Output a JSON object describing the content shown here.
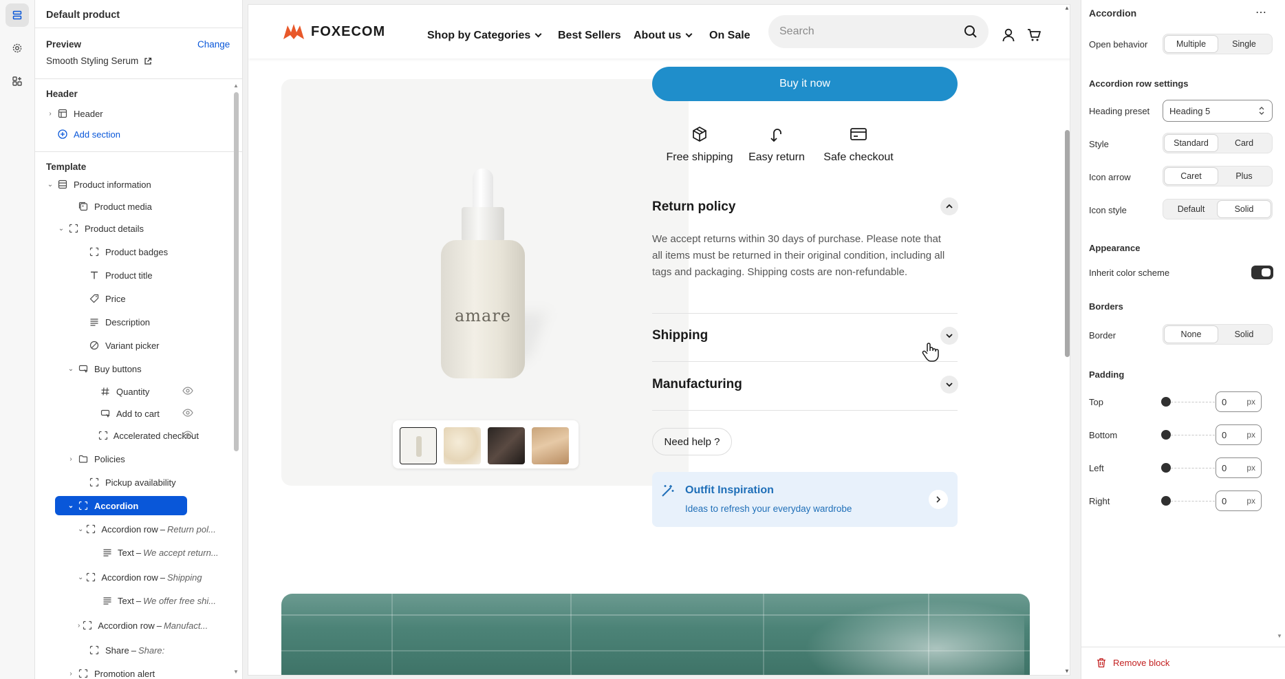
{
  "left_panel": {
    "title": "Default product",
    "preview_label": "Preview",
    "change_link": "Change",
    "preview_value": "Smooth Styling Serum",
    "header_section_title": "Header",
    "header_item": "Header",
    "add_section": "Add section",
    "template_title": "Template",
    "tree": [
      {
        "label": "Product information",
        "sub": ""
      },
      {
        "label": "Product media",
        "sub": ""
      },
      {
        "label": "Product details",
        "sub": ""
      },
      {
        "label": "Product badges",
        "sub": ""
      },
      {
        "label": "Product title",
        "sub": ""
      },
      {
        "label": "Price",
        "sub": ""
      },
      {
        "label": "Description",
        "sub": ""
      },
      {
        "label": "Variant picker",
        "sub": ""
      },
      {
        "label": "Buy buttons",
        "sub": ""
      },
      {
        "label": "Quantity",
        "sub": ""
      },
      {
        "label": "Add to cart",
        "sub": ""
      },
      {
        "label": "Accelerated checkout",
        "sub": ""
      },
      {
        "label": "Policies",
        "sub": ""
      },
      {
        "label": "Pickup availability",
        "sub": ""
      },
      {
        "label": "Accordion",
        "sub": ""
      },
      {
        "label": "Accordion row",
        "sub": "Return pol..."
      },
      {
        "label": "Text",
        "sub": "We accept return..."
      },
      {
        "label": "Accordion row",
        "sub": "Shipping"
      },
      {
        "label": "Text",
        "sub": "We offer free shi..."
      },
      {
        "label": "Accordion row",
        "sub": "Manufact..."
      },
      {
        "label": "Share",
        "sub": "Share:"
      },
      {
        "label": "Promotion alert",
        "sub": ""
      }
    ]
  },
  "store": {
    "logo_text": "FOXECOM",
    "nav": [
      "Shop by Categories",
      "Best Sellers",
      "About us",
      "On Sale"
    ],
    "search_placeholder": "Search",
    "buy_now": "Buy it now",
    "features": [
      "Free shipping",
      "Easy return",
      "Safe checkout"
    ],
    "product_label": "amare",
    "accordion": [
      {
        "title": "Return policy",
        "body": "We accept returns within 30 days of purchase. Please note that all items must be returned in their original condition, including all tags and packaging. Shipping costs are non-refundable."
      },
      {
        "title": "Shipping",
        "body": ""
      },
      {
        "title": "Manufacturing",
        "body": ""
      }
    ],
    "need_help": "Need help ?",
    "promo_title": "Outfit Inspiration",
    "promo_sub": "Ideas to refresh your everyday wardrobe"
  },
  "right_panel": {
    "title": "Accordion",
    "open_behavior": {
      "label": "Open behavior",
      "options": [
        "Multiple",
        "Single"
      ],
      "selected": "Multiple"
    },
    "row_settings_title": "Accordion row settings",
    "heading_preset": {
      "label": "Heading preset",
      "value": "Heading 5"
    },
    "style": {
      "label": "Style",
      "options": [
        "Standard",
        "Card"
      ],
      "selected": "Standard"
    },
    "icon_arrow": {
      "label": "Icon arrow",
      "options": [
        "Caret",
        "Plus"
      ],
      "selected": "Caret"
    },
    "icon_style": {
      "label": "Icon style",
      "options": [
        "Default",
        "Solid"
      ],
      "selected": "Solid"
    },
    "appearance_title": "Appearance",
    "inherit_color": {
      "label": "Inherit color scheme",
      "on": true
    },
    "borders_title": "Borders",
    "border": {
      "label": "Border",
      "options": [
        "None",
        "Solid"
      ],
      "selected": "None"
    },
    "padding_title": "Padding",
    "padding": [
      {
        "label": "Top",
        "value": "0",
        "unit": "px"
      },
      {
        "label": "Bottom",
        "value": "0",
        "unit": "px"
      },
      {
        "label": "Left",
        "value": "0",
        "unit": "px"
      },
      {
        "label": "Right",
        "value": "0",
        "unit": "px"
      }
    ],
    "remove_block": "Remove block"
  },
  "colors": {
    "accent": "#0957d9",
    "brand": "#e8582a",
    "buy_button": "#1f8ecb",
    "promo_bg": "#e8f1fb",
    "promo_text": "#1f6fb8",
    "danger": "#c21f1f"
  }
}
